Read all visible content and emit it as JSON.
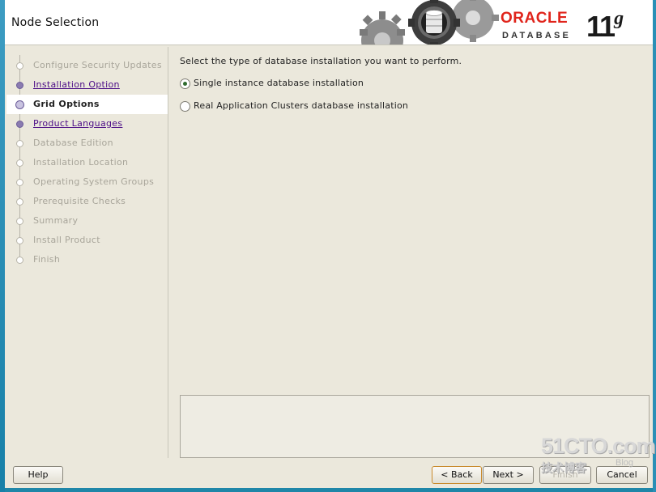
{
  "window": {
    "title": "Node Selection"
  },
  "brand": {
    "oracle": "ORACLE",
    "database": "DATABASE",
    "version": "11",
    "version_suffix": "g"
  },
  "steps": [
    {
      "label": "Configure Security Updates",
      "state": "disabled"
    },
    {
      "label": "Installation Option",
      "state": "done"
    },
    {
      "label": "Grid Options",
      "state": "current"
    },
    {
      "label": "Product Languages",
      "state": "done"
    },
    {
      "label": "Database Edition",
      "state": "disabled"
    },
    {
      "label": "Installation Location",
      "state": "disabled"
    },
    {
      "label": "Operating System Groups",
      "state": "disabled"
    },
    {
      "label": "Prerequisite Checks",
      "state": "disabled"
    },
    {
      "label": "Summary",
      "state": "disabled"
    },
    {
      "label": "Install Product",
      "state": "disabled"
    },
    {
      "label": "Finish",
      "state": "disabled"
    }
  ],
  "content": {
    "prompt": "Select the type of database installation you want to perform.",
    "options": [
      {
        "label": "Single instance database installation",
        "selected": true
      },
      {
        "label": "Real Application Clusters database installation",
        "selected": false
      }
    ]
  },
  "footer": {
    "help": "Help",
    "back": "< Back",
    "next": "Next >",
    "finish": "Finish",
    "cancel": "Cancel"
  },
  "watermark": {
    "line1": "51CTO.com",
    "line2": "技术博客",
    "line3": "Blog"
  },
  "colors": {
    "accent": "#e0241b",
    "link": "#4b0c86",
    "panel": "#ebe8dc"
  }
}
